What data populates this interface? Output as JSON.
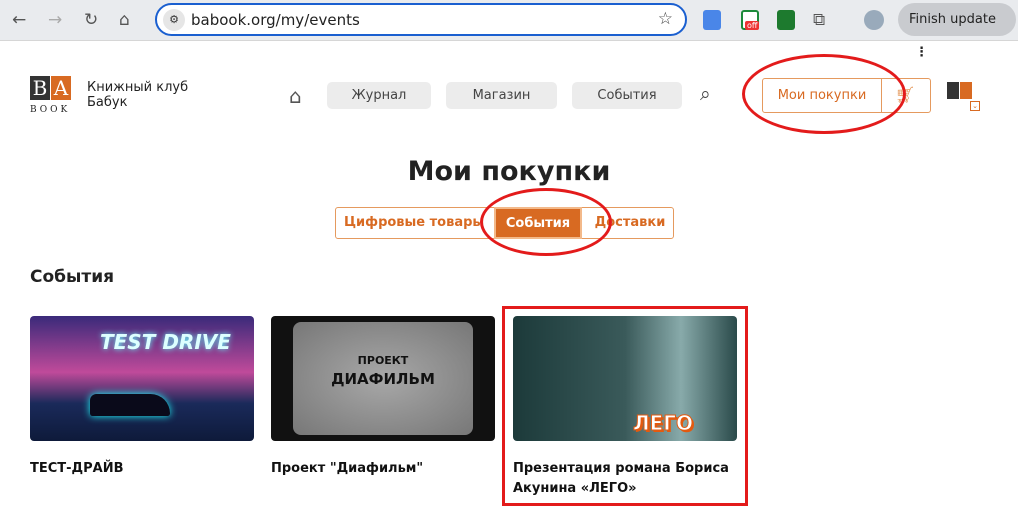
{
  "browser": {
    "url": "babook.org/my/events",
    "finish_update": "Finish update",
    "ext_badge": "off"
  },
  "header": {
    "logo_letters": [
      "B",
      "A"
    ],
    "logo_word": "BOOK",
    "brand_line1": "Книжный клуб",
    "brand_line2": "Бабук",
    "nav": [
      {
        "label": "Журнал"
      },
      {
        "label": "Магазин"
      },
      {
        "label": "События"
      }
    ],
    "my_purchases": "Мои покупки"
  },
  "page": {
    "title": "Мои покупки",
    "tabs": [
      {
        "label": "Цифровые товары"
      },
      {
        "label": "События",
        "active": true
      },
      {
        "label": "Доставки"
      }
    ],
    "section": "События",
    "cards": [
      {
        "title": "ТЕСТ-ДРАЙВ",
        "image_text": "TEST DRIVE"
      },
      {
        "title": "Проект \"Диафильм\"",
        "image_text_1": "ПРОЕКТ",
        "image_text_2": "ДИАФИЛЬМ"
      },
      {
        "title": "Презентация романа Бориса Акунина «ЛЕГО»",
        "image_text": "ЛЕГО"
      }
    ]
  },
  "colors": {
    "accent": "#d86a22",
    "annotation": "#e31b1b",
    "url_border": "#1a5fd0"
  }
}
